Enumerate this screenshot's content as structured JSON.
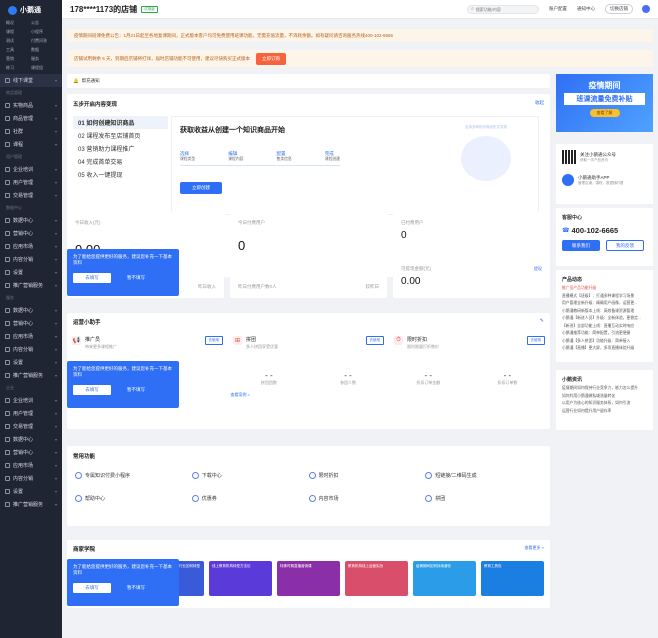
{
  "app": {
    "logo_text": "小鹅通"
  },
  "sidebar": {
    "sub_links": [
      "概况",
      "公告",
      "课程",
      "小程序",
      "测试",
      "付费问答",
      "工具",
      "数据",
      "营销",
      "服务",
      "练习",
      "课程组"
    ],
    "top_item": "线下课堂",
    "sections": [
      {
        "title": "商品管理",
        "items": [
          "实物商品",
          "商品管理",
          "社群",
          "课程"
        ]
      },
      {
        "title": "用户管理",
        "items": [
          "企业培训",
          "用户管理",
          "交易管理"
        ]
      },
      {
        "title": "数据中心",
        "items": [
          "数据中心",
          "营销中心",
          "应用市场",
          "内容分销",
          "设置",
          "推广营销服务"
        ]
      },
      {
        "title": "服务",
        "items": [
          "数据中心",
          "营销中心",
          "应用市场",
          "内容分销",
          "设置",
          "推广营销服务"
        ]
      },
      {
        "title": "企业",
        "items": [
          "企业培训",
          "用户管理",
          "交易管理",
          "数据中心",
          "营销中心",
          "应用市场",
          "内容分销",
          "设置",
          "推广营销服务"
        ]
      }
    ]
  },
  "topbar": {
    "shop_name": "178****1173的店铺",
    "badge": "试用版",
    "search_placeholder": "搜索功能/内容",
    "links": [
      "账户配置",
      "通知中心"
    ],
    "switch_button": "切换店铺"
  },
  "notices": {
    "announcement": "疫情期间班课免费公告：1月21日起至各地复课期间，正式版本客户均可免费使用班课功能，无需充值流量，不消耗余额。如有疑问请咨询服务热线400-102-6665",
    "trial": "店铺试用剩余 6 天，到期后店铺将打烊，届时店铺功能不可使用，建议尽快购买正式版本",
    "trial_button": "立即订购"
  },
  "help_bar": {
    "label": "帮充通知"
  },
  "onboarding": {
    "title": "五步开启内容变现",
    "collapse": "收起",
    "steps": [
      "01 如何创建知识商品",
      "02 课程发布至店铺首页",
      "03 营销助力课程推广",
      "04 完成首单交易",
      "05 收入一键提现"
    ],
    "detail_title": "获取收益从创建一个知识商品开始",
    "detail_sub": "支持多种知识商品形式变现",
    "flow": [
      {
        "name": "选择",
        "desc": "课程类型"
      },
      {
        "name": "编辑",
        "desc": "课程内容"
      },
      {
        "name": "配置",
        "desc": "售卖信息"
      },
      {
        "name": "完成",
        "desc": "课程创建"
      }
    ],
    "create_button": "立即创建"
  },
  "stats": [
    {
      "label": "今日收入(元)",
      "value": "0.00",
      "sub_left": "",
      "sub_right": "昨日收入"
    },
    {
      "label": "今日付费用户",
      "value": "0",
      "sub_left": "昨日付费用户数0人",
      "sub_right": "较昨日"
    },
    {
      "label": "已付费用户",
      "value": "0",
      "sub_left": "",
      "sub_right": ""
    },
    {
      "label": "可提现金额(元)",
      "value": "0.00",
      "sub_left": "",
      "sub_right": "提现"
    }
  ],
  "popup": {
    "text": "为了能给您提供更好的服务，建议您补充一下基本资料",
    "ok": "去填写",
    "skip": "暂不填写"
  },
  "tools": {
    "title": "运营小助手",
    "items": [
      {
        "name": "推广员",
        "desc": "带来更多课程推广",
        "button": "去使用"
      },
      {
        "name": "拼团",
        "desc": "多人拼团享受优惠",
        "button": "去使用"
      },
      {
        "name": "限时折扣",
        "desc": "限时限量打折售价",
        "button": "去使用"
      }
    ],
    "metrics": [
      {
        "value": "- -",
        "label": "推广员订单数"
      },
      {
        "value": "- -",
        "label": "推广订单数"
      },
      {
        "value": "- -",
        "label": "拼团团数"
      },
      {
        "value": "- -",
        "label": "参团人数"
      },
      {
        "value": "- -",
        "label": "折扣订单金额"
      },
      {
        "value": "- -",
        "label": "折扣订单数"
      }
    ],
    "more": "查看案例 >"
  },
  "common": {
    "title": "常用功能",
    "items": [
      "专属知识付费小程序",
      "下载中心",
      "限时折扣",
      "短链接/二维码生成",
      "帮助中心",
      "优惠券",
      "内容市场",
      "拼团"
    ]
  },
  "academy": {
    "title": "商家学院",
    "more": "查看更多 >",
    "courses": [
      {
        "title": "小鹅通",
        "color": "#2f6ff5"
      },
      {
        "title": "新冠疫情下中小学教育行业如何转型",
        "color": "#3a5bd9"
      },
      {
        "title": "线上教育机构转型方法论",
        "color": "#5a3ad9"
      },
      {
        "title": "特殊时期直播营销课",
        "color": "#8a2fa8"
      },
      {
        "title": "教育机构线上运营实战",
        "color": "#d94f6b"
      },
      {
        "title": "疫情期间如何持续营收",
        "color": "#2a9ce8"
      },
      {
        "title": "教育工具包",
        "color": "#1a7fe0"
      }
    ]
  },
  "right": {
    "banner": {
      "line1": "疫情期间",
      "line2": "班课流量免费补贴",
      "button": "查看了解"
    },
    "wechat": {
      "name": "关注小鹅通公众号",
      "desc": "获取一手产品资讯"
    },
    "app": {
      "name": "小鹅通助手APP",
      "desc": "管理店铺，课程，数据随时看"
    },
    "service": {
      "title": "客服中心",
      "phone": "400-102-6665",
      "btn_call": "联系我们",
      "btn_feedback": "我的反馈"
    },
    "news": {
      "title": "产品动态",
      "items": [
        "推广员产品功能升级",
        "直播模式【班级】：打通多种课程学习场景",
        "用户管理全新升级：精确用户画像，运营更...",
        "小鹅通教研新版本上线：高效备课资源管理",
        "小鹅通【新进人员】升级：全新体验，更稳定...",
        "【新进】全部功能上线：直播互动实时响应",
        "小鹅通推荐功能：简单配置，引流更便捷",
        "小鹅通【多人拼团】功能升级：简单接入",
        "小鹅通【直播】更大屏，多项直播体验升级"
      ]
    },
    "info": {
      "title": "小鹅资讯",
      "items": [
        "疫情期间如何保持行业竞争力，能力怎么提升",
        "如何利用小鹅通做私域流量转化",
        "以用户为核心的知识服务体系，如何引流",
        "运营行业如何提升用户留存率"
      ]
    }
  }
}
